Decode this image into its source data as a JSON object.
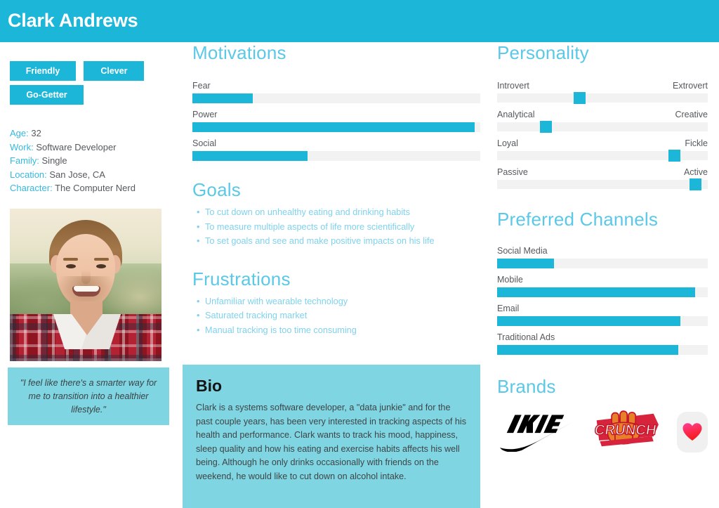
{
  "header": {
    "name": "Clark Andrews",
    "bg_color": "#1cb6d8"
  },
  "profile": {
    "tags": [
      "Friendly",
      "Clever",
      "Go-Getter"
    ],
    "demographics": [
      {
        "label": "Age:",
        "value": "32"
      },
      {
        "label": "Work:",
        "value": "Software Developer"
      },
      {
        "label": "Family:",
        "value": "Single"
      },
      {
        "label": "Location:",
        "value": "San Jose, CA"
      },
      {
        "label": "Character:",
        "value": "The Computer Nerd"
      }
    ],
    "photo_alt": "portrait-photo",
    "quote": "\"I feel like there's a smarter way for me to transition into a healthier lifestyle.\""
  },
  "motivations": {
    "title": "Motivations",
    "chart_data": {
      "type": "bar",
      "title": "Motivations",
      "categories": [
        "Fear",
        "Power",
        "Social"
      ],
      "values": [
        21,
        98,
        40
      ],
      "xlabel": "",
      "ylabel": "",
      "ylim": [
        0,
        100
      ],
      "orientation": "horizontal",
      "grid": false
    }
  },
  "goals": {
    "title": "Goals",
    "items": [
      "To cut down on unhealthy eating and drinking habits",
      "To measure multiple aspects of life more scientifically",
      "To set goals and see and make positive impacts on his life"
    ]
  },
  "frustrations": {
    "title": "Frustrations",
    "items": [
      "Unfamiliar with wearable technology",
      "Saturated tracking market",
      "Manual tracking is too time consuming"
    ]
  },
  "bio": {
    "title": "Bio",
    "text": "Clark is a systems software developer, a \"data junkie\" and for the past couple years, has been very interested in tracking aspects of his health and performance. Clark wants to track his mood, happiness, sleep quality and how his eating and exercise habits affects his well being. Although he only drinks occasionally with friends on the weekend, he would like to cut down on alcohol intake."
  },
  "personality": {
    "title": "Personality",
    "chart_data": {
      "type": "bar",
      "title": "Personality",
      "categories": [
        "Introvert-Extrovert",
        "Analytical-Creative",
        "Loyal-Fickle",
        "Passive-Active"
      ],
      "values": [
        39,
        23,
        84,
        94
      ],
      "ylim": [
        0,
        100
      ],
      "orientation": "horizontal",
      "grid": false
    },
    "traits": [
      {
        "left": "Introvert",
        "right": "Extrovert",
        "position": 39
      },
      {
        "left": "Analytical",
        "right": "Creative",
        "position": 23
      },
      {
        "left": "Loyal",
        "right": "Fickle",
        "position": 84
      },
      {
        "left": "Passive",
        "right": "Active",
        "position": 94
      }
    ]
  },
  "channels": {
    "title": "Preferred Channels",
    "chart_data": {
      "type": "bar",
      "title": "Preferred Channels",
      "categories": [
        "Social Media",
        "Mobile",
        "Email",
        "Traditional Ads"
      ],
      "values": [
        27,
        94,
        87,
        86
      ],
      "ylim": [
        0,
        100
      ],
      "orientation": "horizontal",
      "grid": false
    }
  },
  "brands": {
    "title": "Brands",
    "items": [
      {
        "name": "NIKE",
        "icon": "nike-logo"
      },
      {
        "name": "CRUNCH",
        "icon": "crunch-logo"
      },
      {
        "name": "Health",
        "icon": "apple-health-icon"
      }
    ]
  },
  "colors": {
    "accent": "#1cb6d8",
    "accent_light": "#7fd6e2",
    "heading": "#5bc8e8",
    "track": "#f2f2f2",
    "text": "#55595c"
  }
}
